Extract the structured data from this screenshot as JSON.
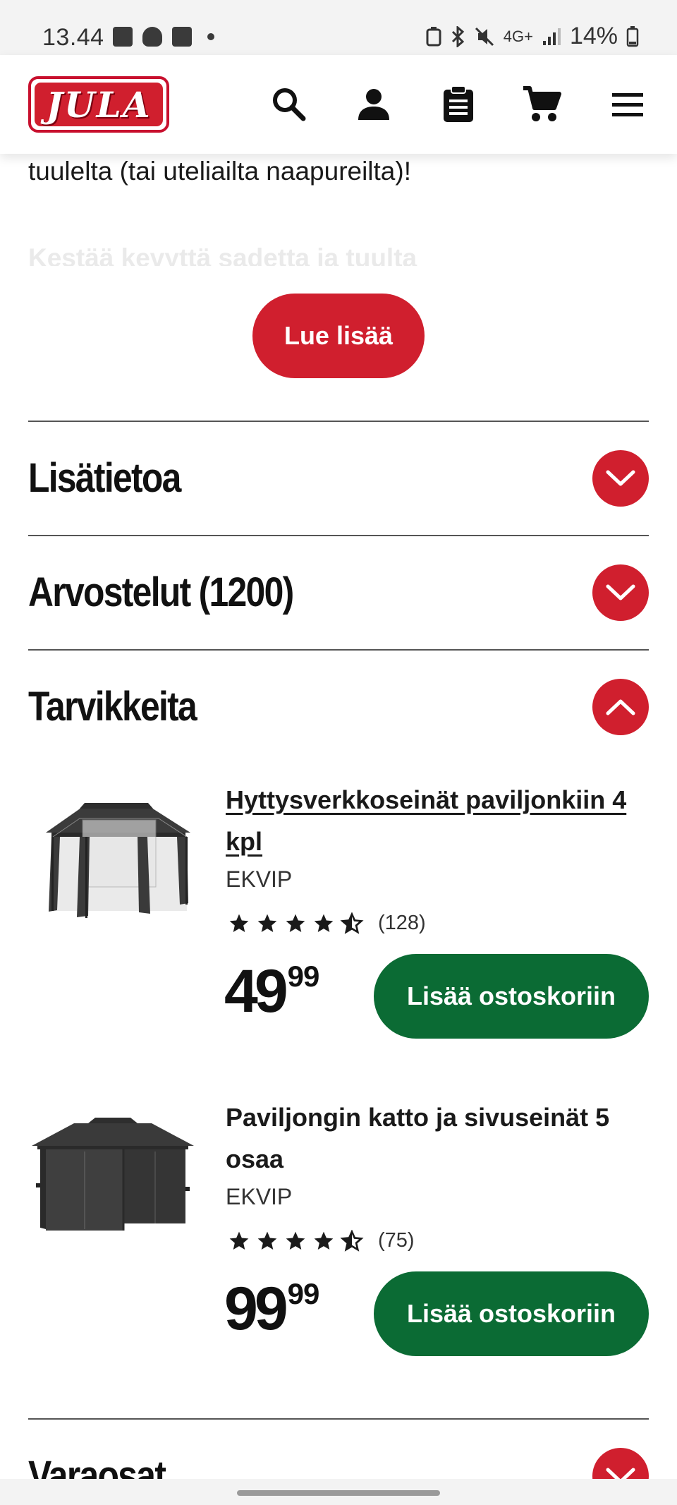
{
  "status_bar": {
    "time": "13.44",
    "network": "4G+",
    "battery": "14%"
  },
  "header": {
    "logo_text": "JULA",
    "icons": [
      "search-icon",
      "user-icon",
      "clipboard-icon",
      "cart-icon",
      "menu-icon"
    ]
  },
  "intro": {
    "text": "tuulelta (tai uteliailta naapureilta)!",
    "faded_text": "Kestää kevyttä sadetta ja tuulta",
    "read_more": "Lue lisää"
  },
  "accordion": {
    "info": {
      "title": "Lisätietoa",
      "state": "collapsed"
    },
    "reviews": {
      "title": "Arvostelut (1200)",
      "state": "collapsed"
    },
    "accessories": {
      "title": "Tarvikkeita",
      "state": "expanded"
    },
    "spare_parts": {
      "title": "Varaosat",
      "state": "collapsed"
    }
  },
  "products": [
    {
      "name": "Hyttysverkkoseinät paviljonkiin 4 kpl",
      "brand": "EKVIP",
      "rating": 4.5,
      "review_count": "(128)",
      "price_int": "49",
      "price_dec": "99",
      "add_to_cart": "Lisää ostoskoriin"
    },
    {
      "name": "Paviljongin katto ja sivuseinät 5 osaa",
      "brand": "EKVIP",
      "rating": 4.5,
      "review_count": "(75)",
      "price_int": "99",
      "price_dec": "99",
      "add_to_cart": "Lisää ostoskoriin"
    }
  ],
  "colors": {
    "brand_red": "#d01f2e",
    "cart_green": "#0b6b34"
  }
}
